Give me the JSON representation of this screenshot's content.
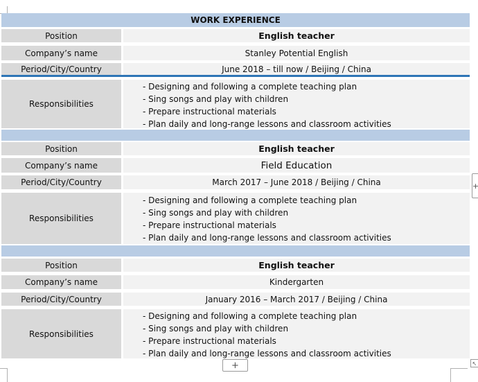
{
  "section_title": "WORK EXPERIENCE",
  "labels": {
    "position": "Position",
    "company": "Company’s name",
    "period": "Period/City/Country",
    "responsibilities": "Responsibilities"
  },
  "jobs": [
    {
      "position": "English teacher",
      "company": "Stanley Potential English",
      "period": "June 2018 – till now / Beijing / China",
      "responsibilities": [
        "- Designing and following a complete teaching plan",
        "- Sing songs and play with children",
        "- Prepare instructional materials",
        "- Plan daily and long-range lessons and classroom activities"
      ]
    },
    {
      "position": "English teacher",
      "company": "Field Education",
      "period": "March 2017 – June 2018 / Beijing / China",
      "responsibilities": [
        "- Designing and following a complete teaching plan",
        "- Sing songs and play with children",
        "- Prepare instructional materials",
        "- Plan daily and long-range lessons and classroom activities"
      ]
    },
    {
      "position": "English teacher",
      "company": "Kindergarten",
      "period": "January 2016 – March 2017 / Beijing / China",
      "responsibilities": [
        "- Designing and following a complete teaching plan",
        "- Sing songs and play with children",
        "- Prepare instructional materials",
        "- Plan daily and long-range lessons and classroom activities"
      ]
    }
  ],
  "controls": {
    "add_row": "+",
    "add_column": "+",
    "resize": "↖"
  },
  "colors": {
    "header_band": "#b8cce4",
    "label_cell": "#d9d9d9",
    "value_cell": "#f2f2f2",
    "selection_line": "#2e75b6"
  }
}
